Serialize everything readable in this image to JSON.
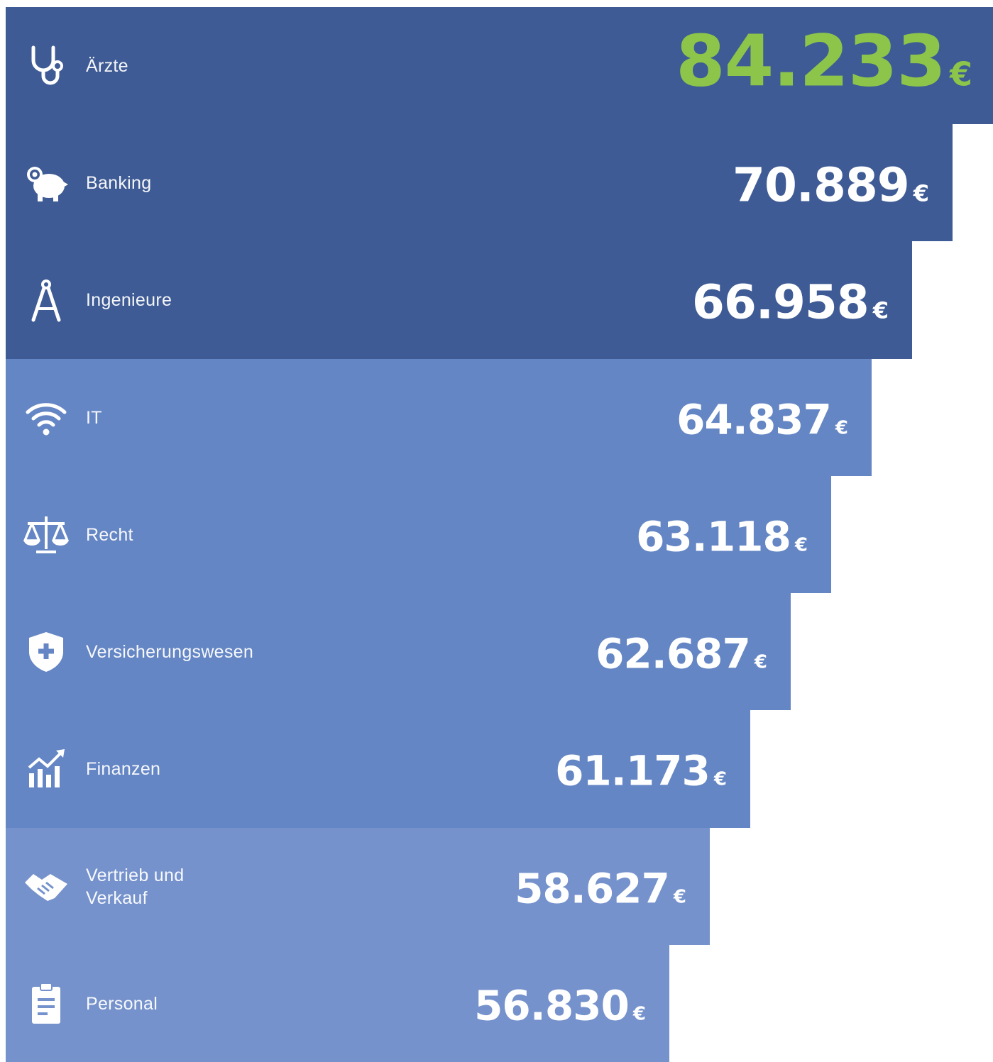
{
  "chart_data": {
    "type": "bar",
    "orientation": "horizontal",
    "currency": "€",
    "categories": [
      "Ärzte",
      "Banking",
      "Ingenieure",
      "IT",
      "Recht",
      "Versicherungswesen",
      "Finanzen",
      "Vertrieb und\nVerkauf",
      "Personal"
    ],
    "values": [
      84233,
      70889,
      66958,
      64837,
      63118,
      62687,
      61173,
      58627,
      56830
    ],
    "value_labels": [
      "84.233",
      "70.889",
      "66.958",
      "64.837",
      "63.118",
      "62.687",
      "61.173",
      "58.627",
      "56.830"
    ],
    "icons": [
      "stethoscope-icon",
      "piggy-bank-icon",
      "compass-icon",
      "wifi-icon",
      "scales-icon",
      "shield-plus-icon",
      "growth-chart-icon",
      "handshake-icon",
      "clipboard-icon"
    ],
    "colors": [
      "#3e5b95",
      "#3e5b95",
      "#3e5b95",
      "#6486c4",
      "#6486c4",
      "#6486c4",
      "#6486c4",
      "#7592cc",
      "#7592cc"
    ],
    "highlight_value_color": "#8cc54a",
    "legend": "none",
    "grid": false
  }
}
